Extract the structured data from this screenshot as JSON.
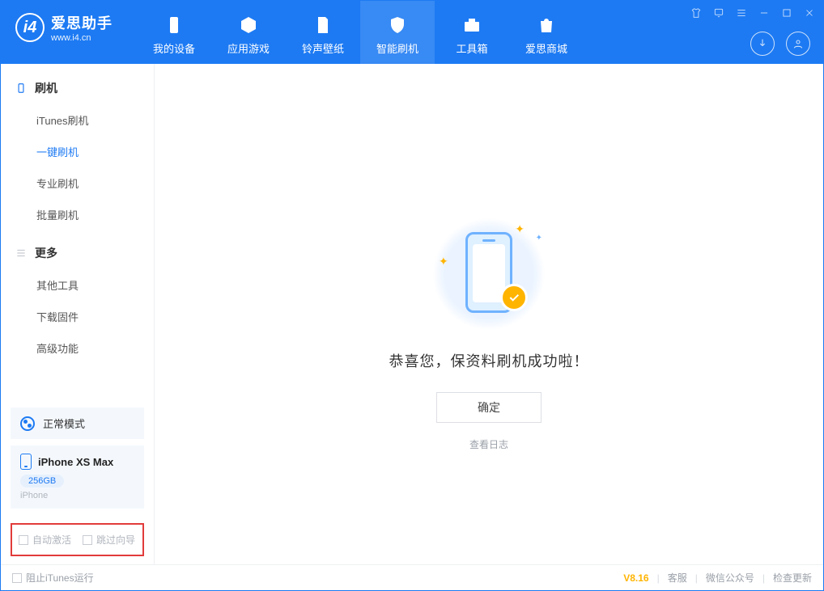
{
  "brand": {
    "title": "爱思助手",
    "subtitle": "www.i4.cn"
  },
  "tabs": {
    "device": "我的设备",
    "apps": "应用游戏",
    "ringtones": "铃声壁纸",
    "flash": "智能刷机",
    "toolbox": "工具箱",
    "store": "爱思商城"
  },
  "sidebar": {
    "group_flash": "刷机",
    "items_flash": {
      "itunes": "iTunes刷机",
      "onekey": "一键刷机",
      "pro": "专业刷机",
      "batch": "批量刷机"
    },
    "group_more": "更多",
    "items_more": {
      "other": "其他工具",
      "firmware": "下载固件",
      "advanced": "高级功能"
    },
    "mode": "正常模式",
    "device_name": "iPhone XS Max",
    "device_storage": "256GB",
    "device_type": "iPhone",
    "auto_activate": "自动激活",
    "skip_guide": "跳过向导"
  },
  "main": {
    "success_text": "恭喜您，保资料刷机成功啦！",
    "ok": "确定",
    "view_log": "查看日志"
  },
  "footer": {
    "block_itunes": "阻止iTunes运行",
    "version": "V8.16",
    "support": "客服",
    "wechat": "微信公众号",
    "update": "检查更新"
  }
}
